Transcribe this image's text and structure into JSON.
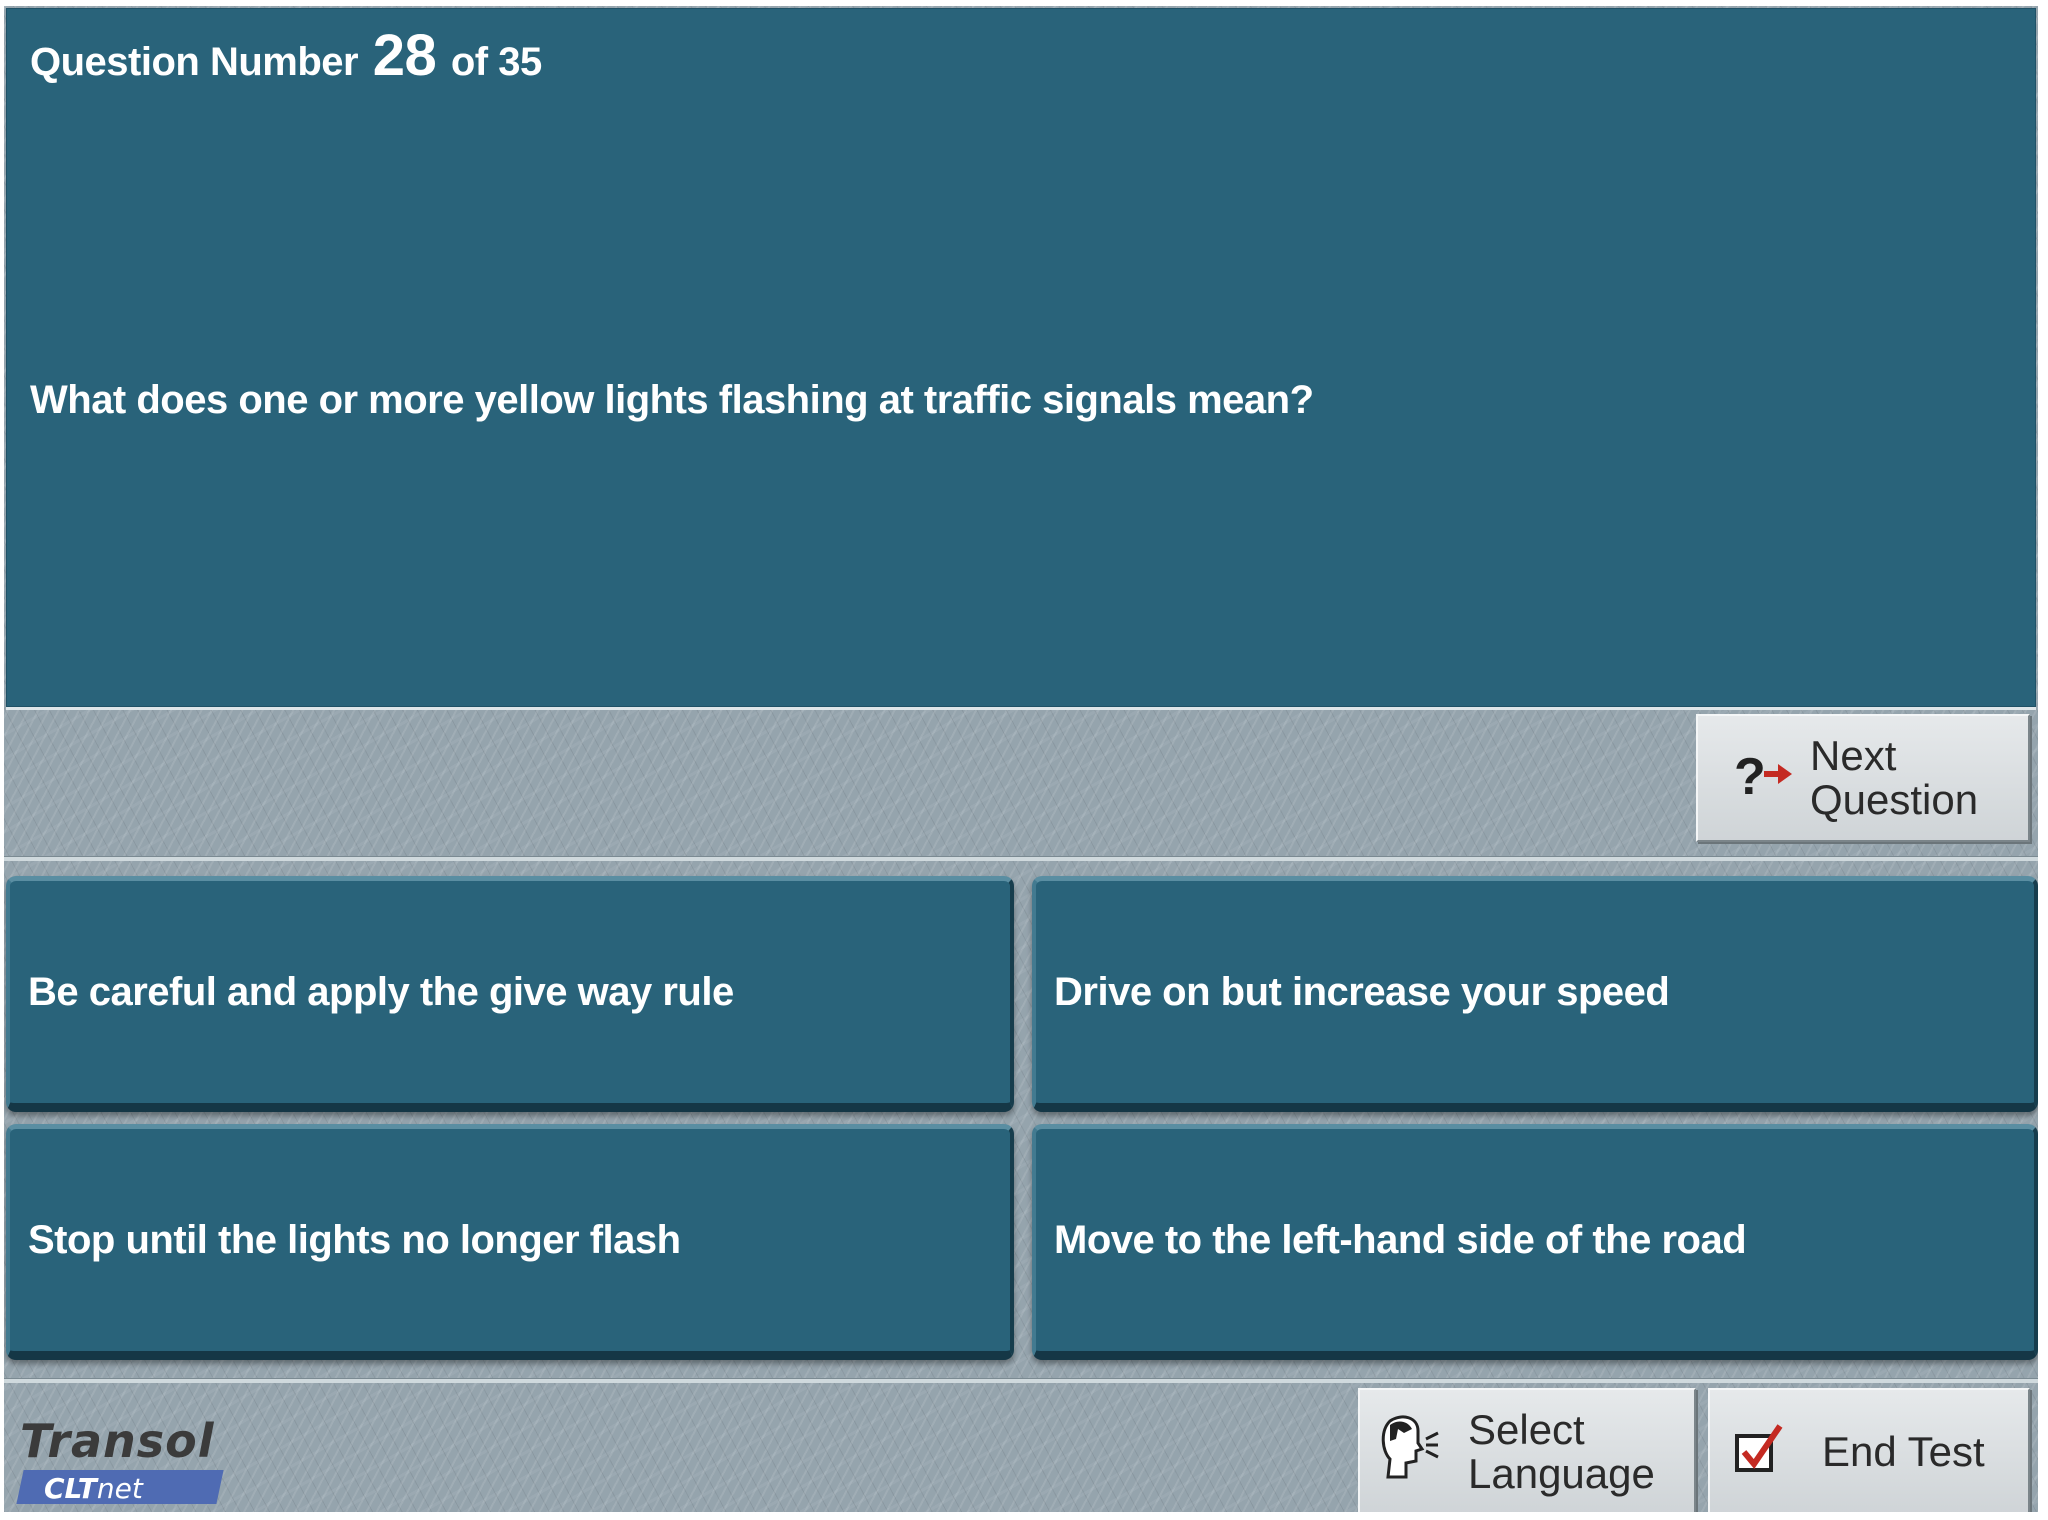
{
  "question": {
    "label_prefix": "Question Number",
    "current": "28",
    "label_suffix": "of 35",
    "text": "What does one or more yellow lights flashing at traffic signals mean?"
  },
  "next_button": {
    "label_line1": "Next",
    "label_line2": "Question",
    "icon": "question-arrow-icon"
  },
  "answers": [
    {
      "text": "Be careful and apply the give way rule"
    },
    {
      "text": "Drive on but increase your speed"
    },
    {
      "text": "Stop until the lights no longer flash"
    },
    {
      "text": "Move to the left-hand side of the road"
    }
  ],
  "footer": {
    "logo_main": "Transol",
    "logo_sub_bold": "CLT",
    "logo_sub": "net",
    "select_language": {
      "line1": "Select",
      "line2": "Language",
      "icon": "speaking-head-icon"
    },
    "end_test": {
      "label": "End Test",
      "icon": "checkbox-tick-icon"
    }
  },
  "colors": {
    "panel": "#29637a",
    "arrow_red": "#c42a22"
  }
}
